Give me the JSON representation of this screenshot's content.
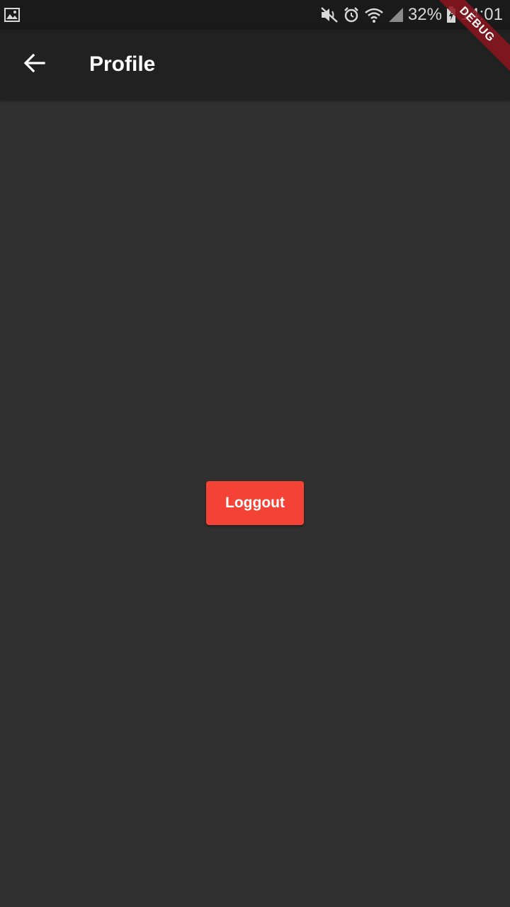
{
  "status_bar": {
    "battery_percent": "32%",
    "time": "14:01",
    "icons": [
      "gallery-icon",
      "mute-icon",
      "alarm-icon",
      "wifi-icon",
      "signal-icon",
      "battery-icon"
    ]
  },
  "app_bar": {
    "title": "Profile",
    "back_icon": "arrow-back-icon"
  },
  "main": {
    "logout_label": "Loggout"
  },
  "debug_banner": {
    "label": "DEBUG"
  },
  "colors": {
    "background": "#303030",
    "app_bar": "#212121",
    "status_bar": "#1a1a1a",
    "button": "#f44336",
    "debug_ribbon": "#8c141e"
  }
}
